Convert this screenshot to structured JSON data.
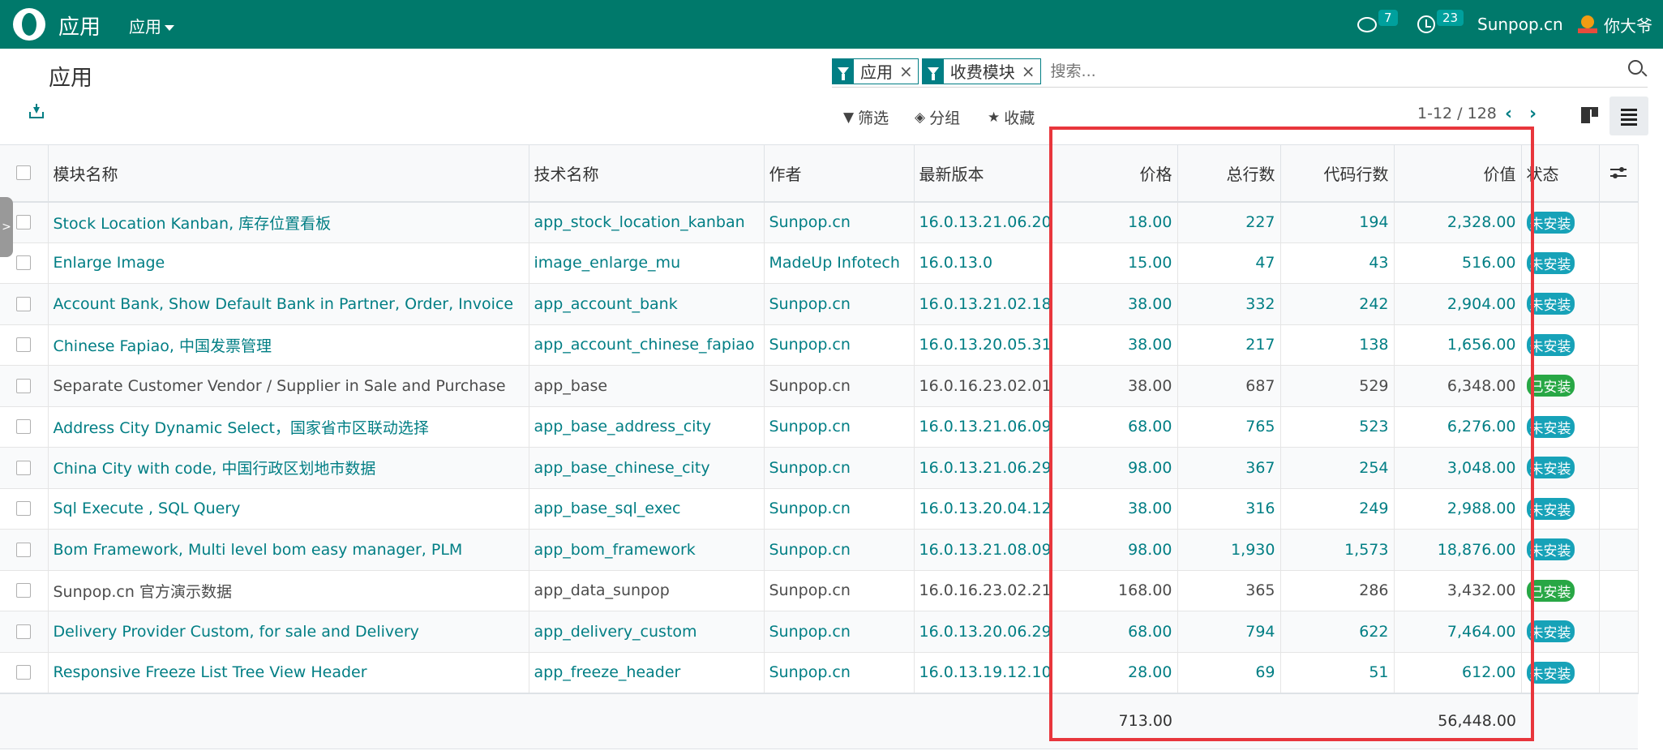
{
  "navbar": {
    "app_name": "应用",
    "menu_label": "应用",
    "messages_count": "7",
    "activities_count": "23",
    "company": "Sunpop.cn",
    "user_name": "你大爷"
  },
  "control_panel": {
    "breadcrumb": "应用",
    "facets": [
      {
        "label": "应用"
      },
      {
        "label": "收费模块"
      }
    ],
    "search_placeholder": "搜索...",
    "filter_label": "筛选",
    "group_label": "分组",
    "favorites_label": "收藏",
    "pager": "1-12 / 128"
  },
  "table": {
    "columns": [
      "模块名称",
      "技术名称",
      "作者",
      "最新版本",
      "价格",
      "总行数",
      "代码行数",
      "价值",
      "状态"
    ],
    "rows": [
      {
        "name": "Stock Location Kanban, 库存位置看板",
        "tech": "app_stock_location_kanban",
        "author": "Sunpop.cn",
        "version": "16.0.13.21.06.20",
        "price": "18.00",
        "total_lines": "227",
        "code_lines": "194",
        "value": "2,328.00",
        "state": "未安装",
        "installed": false
      },
      {
        "name": "Enlarge Image",
        "tech": "image_enlarge_mu",
        "author": "MadeUp Infotech",
        "version": "16.0.13.0",
        "price": "15.00",
        "total_lines": "47",
        "code_lines": "43",
        "value": "516.00",
        "state": "未安装",
        "installed": false
      },
      {
        "name": "Account Bank, Show Default Bank in Partner, Order, Invoice",
        "tech": "app_account_bank",
        "author": "Sunpop.cn",
        "version": "16.0.13.21.02.18",
        "price": "38.00",
        "total_lines": "332",
        "code_lines": "242",
        "value": "2,904.00",
        "state": "未安装",
        "installed": false
      },
      {
        "name": "Chinese Fapiao, 中国发票管理",
        "tech": "app_account_chinese_fapiao",
        "author": "Sunpop.cn",
        "version": "16.0.13.20.05.31",
        "price": "38.00",
        "total_lines": "217",
        "code_lines": "138",
        "value": "1,656.00",
        "state": "未安装",
        "installed": false
      },
      {
        "name": "Separate Customer Vendor / Supplier in Sale and Purchase",
        "tech": "app_base",
        "author": "Sunpop.cn",
        "version": "16.0.16.23.02.01",
        "price": "38.00",
        "total_lines": "687",
        "code_lines": "529",
        "value": "6,348.00",
        "state": "已安装",
        "installed": true
      },
      {
        "name": "Address City Dynamic Select，国家省市区联动选择",
        "tech": "app_base_address_city",
        "author": "Sunpop.cn",
        "version": "16.0.13.21.06.09",
        "price": "68.00",
        "total_lines": "765",
        "code_lines": "523",
        "value": "6,276.00",
        "state": "未安装",
        "installed": false
      },
      {
        "name": "China City with code, 中国行政区划地市数据",
        "tech": "app_base_chinese_city",
        "author": "Sunpop.cn",
        "version": "16.0.13.21.06.29",
        "price": "98.00",
        "total_lines": "367",
        "code_lines": "254",
        "value": "3,048.00",
        "state": "未安装",
        "installed": false
      },
      {
        "name": "Sql Execute , SQL Query",
        "tech": "app_base_sql_exec",
        "author": "Sunpop.cn",
        "version": "16.0.13.20.04.12",
        "price": "38.00",
        "total_lines": "316",
        "code_lines": "249",
        "value": "2,988.00",
        "state": "未安装",
        "installed": false
      },
      {
        "name": "Bom Framework, Multi level bom easy manager, PLM",
        "tech": "app_bom_framework",
        "author": "Sunpop.cn",
        "version": "16.0.13.21.08.09",
        "price": "98.00",
        "total_lines": "1,930",
        "code_lines": "1,573",
        "value": "18,876.00",
        "state": "未安装",
        "installed": false
      },
      {
        "name": "Sunpop.cn 官方演示数据",
        "tech": "app_data_sunpop",
        "author": "Sunpop.cn",
        "version": "16.0.16.23.02.21",
        "price": "168.00",
        "total_lines": "365",
        "code_lines": "286",
        "value": "3,432.00",
        "state": "已安装",
        "installed": true
      },
      {
        "name": "Delivery Provider Custom, for sale and Delivery",
        "tech": "app_delivery_custom",
        "author": "Sunpop.cn",
        "version": "16.0.13.20.06.29",
        "price": "68.00",
        "total_lines": "794",
        "code_lines": "622",
        "value": "7,464.00",
        "state": "未安装",
        "installed": false
      },
      {
        "name": "Responsive Freeze List Tree View Header",
        "tech": "app_freeze_header",
        "author": "Sunpop.cn",
        "version": "16.0.13.19.12.10",
        "price": "28.00",
        "total_lines": "69",
        "code_lines": "51",
        "value": "612.00",
        "state": "未安装",
        "installed": false
      }
    ],
    "totals": {
      "price": "713.00",
      "value": "56,448.00"
    }
  },
  "colors": {
    "navbar": "#00796b",
    "link": "#017e84",
    "not_installed": "#17a2b8",
    "installed": "#28a745",
    "highlight": "#e8363c"
  }
}
